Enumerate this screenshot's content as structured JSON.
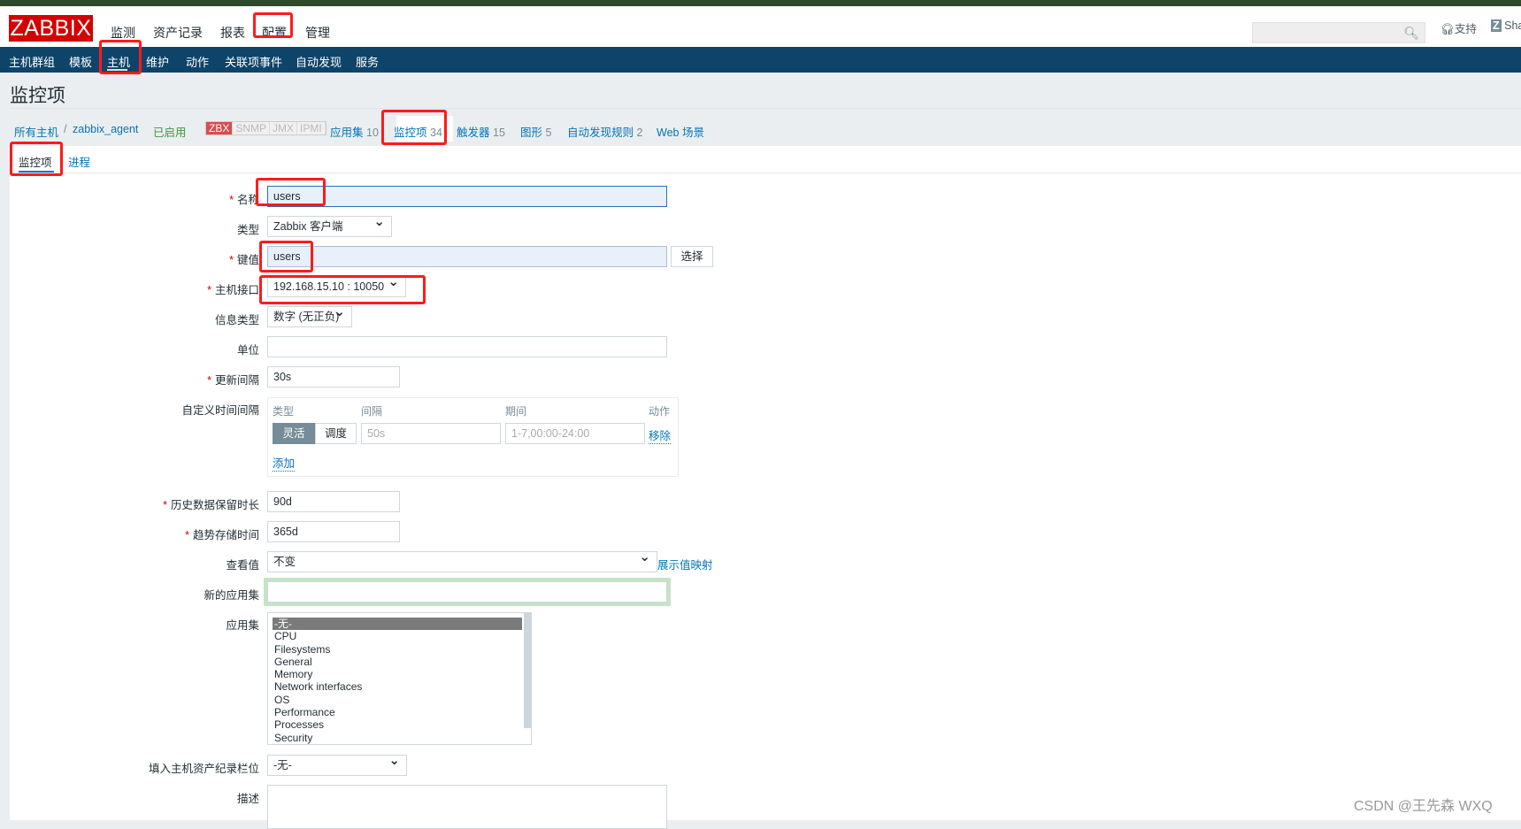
{
  "header": {
    "logo": "ZABBIX",
    "menu": [
      "监测",
      "资产记录",
      "报表",
      "配置",
      "管理"
    ],
    "active_menu": "配置",
    "support": "支持",
    "share": "Share",
    "search_icon": "search-icon"
  },
  "subnav": {
    "items": [
      "主机群组",
      "模板",
      "主机",
      "维护",
      "动作",
      "关联项事件",
      "自动发现",
      "服务"
    ],
    "active": "主机"
  },
  "page": {
    "title": "监控项"
  },
  "breadcrumb": {
    "all_hosts": "所有主机",
    "sep": "/",
    "host": "zabbix_agent",
    "status": "已启用",
    "badges": [
      "ZBX",
      "SNMP",
      "JMX",
      "IPMI"
    ],
    "links": [
      {
        "label": "应用集",
        "count": "10"
      },
      {
        "label": "监控项",
        "count": "34"
      },
      {
        "label": "触发器",
        "count": "15"
      },
      {
        "label": "图形",
        "count": "5"
      },
      {
        "label": "自动发现规则",
        "count": "2"
      },
      {
        "label": "Web 场景",
        "count": ""
      }
    ]
  },
  "tabs": [
    "监控项",
    "进程"
  ],
  "form": {
    "name": {
      "label": "名称",
      "value": "users"
    },
    "type": {
      "label": "类型",
      "value": "Zabbix 客户端"
    },
    "key": {
      "label": "键值",
      "value": "users",
      "button": "选择"
    },
    "interface": {
      "label": "主机接口",
      "value": "192.168.15.10 : 10050"
    },
    "info_type": {
      "label": "信息类型",
      "value": "数字 (无正负)"
    },
    "units": {
      "label": "单位",
      "value": ""
    },
    "interval": {
      "label": "更新间隔",
      "value": "30s"
    },
    "custom": {
      "label": "自定义时间间隔",
      "headers": [
        "类型",
        "间隔",
        "期间",
        "动作"
      ],
      "toggle": [
        "灵活",
        "调度"
      ],
      "interval_placeholder": "50s",
      "period_placeholder": "1-7,00:00-24:00",
      "remove": "移除",
      "add": "添加"
    },
    "history": {
      "label": "历史数据保留时长",
      "value": "90d"
    },
    "trends": {
      "label": "趋势存储时间",
      "value": "365d"
    },
    "valuemap": {
      "label": "查看值",
      "value": "不变",
      "link": "展示值映射"
    },
    "new_app": {
      "label": "新的应用集",
      "value": ""
    },
    "apps": {
      "label": "应用集",
      "options": [
        "-无-",
        "CPU",
        "Filesystems",
        "General",
        "Memory",
        "Network interfaces",
        "OS",
        "Performance",
        "Processes",
        "Security"
      ],
      "selected": "-无-"
    },
    "inventory": {
      "label": "填入主机资产纪录栏位",
      "value": "-无-"
    },
    "description": {
      "label": "描述",
      "value": ""
    }
  },
  "watermark": "CSDN @王先森 WXQ",
  "colors": {
    "brand": "#d40000",
    "nav": "#0e4469",
    "link": "#0275b8",
    "highlight": "#ff1a1a"
  }
}
